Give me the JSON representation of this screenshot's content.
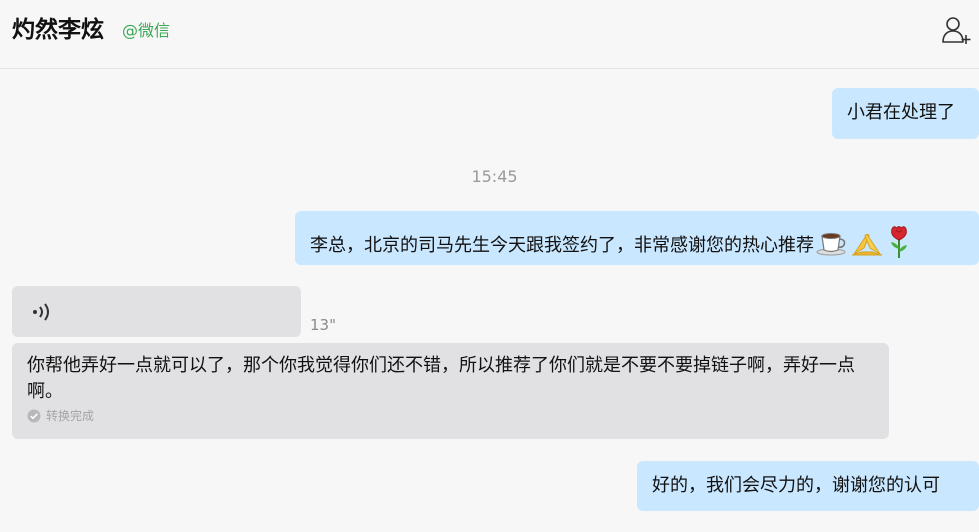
{
  "header": {
    "contact_name": "灼然李炫",
    "source_label": "@微信",
    "add_contact_icon": "add-user-icon"
  },
  "messages": [
    {
      "direction": "sent",
      "type": "text",
      "text": "小君在处理了"
    },
    {
      "type": "timestamp",
      "text": "15:45"
    },
    {
      "direction": "sent",
      "type": "text",
      "text": "李总，北京的司马先生今天跟我签约了，非常感谢您的热心推荐",
      "emojis": [
        "coffee-emoji",
        "folded-hands-emoji",
        "rose-emoji"
      ]
    },
    {
      "direction": "received",
      "type": "voice",
      "duration": "13\""
    },
    {
      "direction": "received",
      "type": "transcript",
      "text": "你帮他弄好一点就可以了，那个你我觉得你们还不错，所以推荐了你们就是不要不要掉链子啊，弄好一点啊。",
      "status": "转换完成"
    },
    {
      "direction": "sent",
      "type": "text",
      "text": "好的，我们会尽力的，谢谢您的认可"
    }
  ],
  "colors": {
    "sent_bubble": "#c9e7ff",
    "received_bubble": "#e1e1e4",
    "source_label": "#3aa856",
    "background": "#f7f7f7"
  }
}
